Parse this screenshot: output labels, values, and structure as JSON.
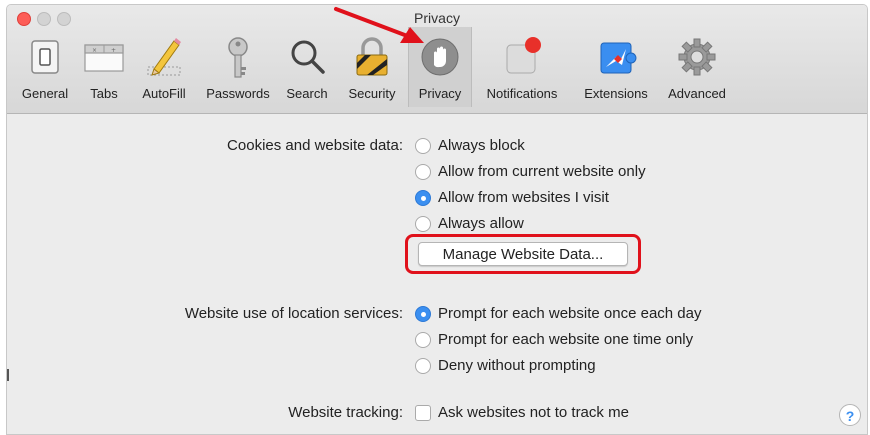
{
  "window": {
    "title": "Privacy"
  },
  "toolbar": {
    "items": [
      {
        "label": "General",
        "icon": "general-switch-icon"
      },
      {
        "label": "Tabs",
        "icon": "tabs-icon"
      },
      {
        "label": "AutoFill",
        "icon": "pencil-icon"
      },
      {
        "label": "Passwords",
        "icon": "key-icon"
      },
      {
        "label": "Search",
        "icon": "magnifier-icon"
      },
      {
        "label": "Security",
        "icon": "lock-icon"
      },
      {
        "label": "Privacy",
        "icon": "hand-icon",
        "selected": true
      },
      {
        "label": "Notifications",
        "icon": "notification-badge-icon"
      },
      {
        "label": "Extensions",
        "icon": "puzzle-icon"
      },
      {
        "label": "Advanced",
        "icon": "gear-icon"
      }
    ]
  },
  "cookies": {
    "label": "Cookies and website data:",
    "options": [
      {
        "label": "Always block",
        "selected": false
      },
      {
        "label": "Allow from current website only",
        "selected": false
      },
      {
        "label": "Allow from websites I visit",
        "selected": true
      },
      {
        "label": "Always allow",
        "selected": false
      }
    ],
    "manage_button": "Manage Website Data..."
  },
  "location": {
    "label": "Website use of location services:",
    "options": [
      {
        "label": "Prompt for each website once each day",
        "selected": true
      },
      {
        "label": "Prompt for each website one time only",
        "selected": false
      },
      {
        "label": "Deny without prompting",
        "selected": false
      }
    ]
  },
  "tracking": {
    "label": "Website tracking:",
    "checkbox_label": "Ask websites not to track me",
    "checked": false
  },
  "help": {
    "label": "?"
  },
  "colors": {
    "accent": "#3b8ff0",
    "highlight": "#e0111b",
    "close": "#fd5d57"
  }
}
